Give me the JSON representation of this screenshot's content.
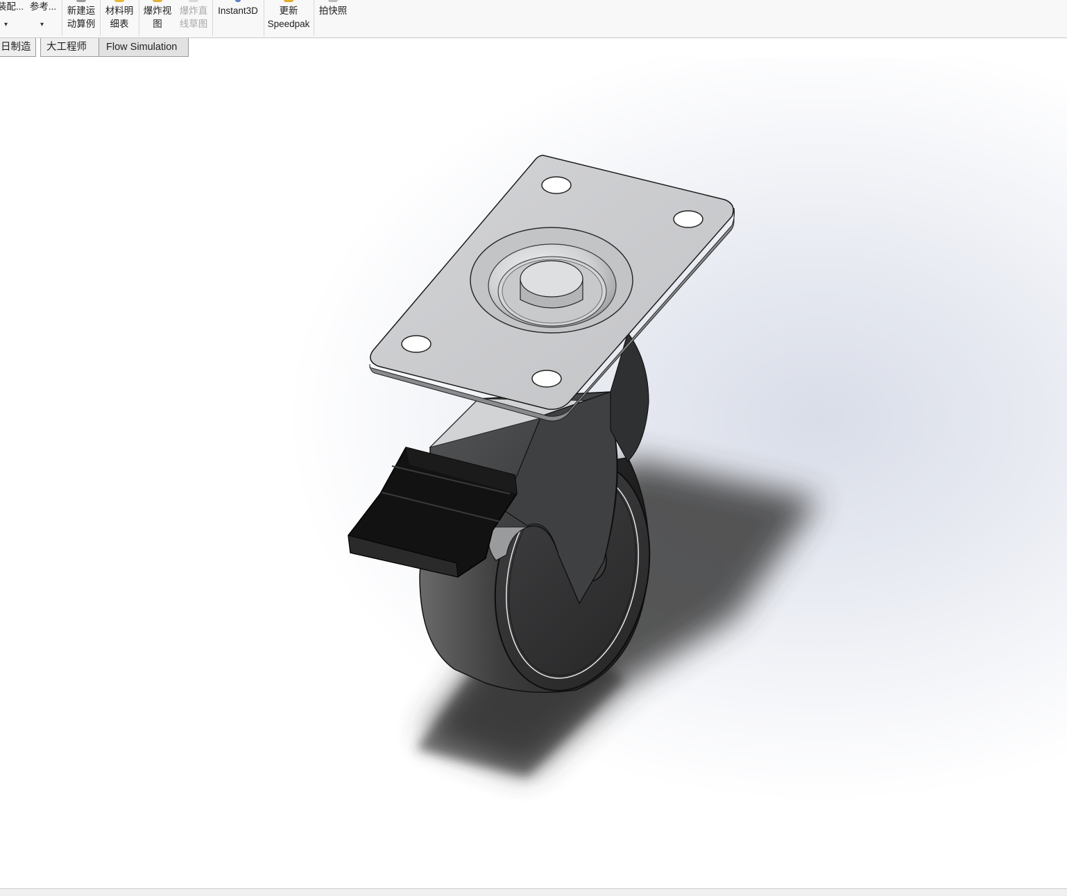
{
  "ribbon": {
    "items": [
      {
        "label_1": "装配...",
        "label_2": ""
      },
      {
        "label_1": "参考...",
        "label_2": ""
      },
      {
        "label_1": "新建运",
        "label_2": "动算例"
      },
      {
        "label_1": "材料明",
        "label_2": "细表"
      },
      {
        "label_1": "爆炸视",
        "label_2": "图"
      },
      {
        "label_1": "爆炸直",
        "label_2": "线草图"
      },
      {
        "label_1": "Instant3D",
        "label_2": ""
      },
      {
        "label_1": "更新",
        "label_2": "Speedpak"
      },
      {
        "label_1": "拍快照",
        "label_2": ""
      }
    ]
  },
  "tabs": [
    {
      "label": "日制造"
    },
    {
      "label": "大工程师"
    },
    {
      "label": "Flow Simulation"
    }
  ],
  "heads_up_toolbar": {
    "icons": [
      "zoom-to-fit-icon",
      "zoom-to-area-icon",
      "previous-view-icon",
      "section-view-icon",
      "dynamic-annotation-icon",
      "view-orientation-icon",
      "display-style-icon",
      "hide-show-items-icon",
      "edit-appearance-icon",
      "apply-scene-icon",
      "view-settings-icon"
    ]
  },
  "model": {
    "name": "swivel-caster-with-brake",
    "colors": {
      "plate": "#c9cacd",
      "bracket": "#3a3b3c",
      "wheel": "#2b2b2c",
      "brake": "#111111"
    }
  }
}
